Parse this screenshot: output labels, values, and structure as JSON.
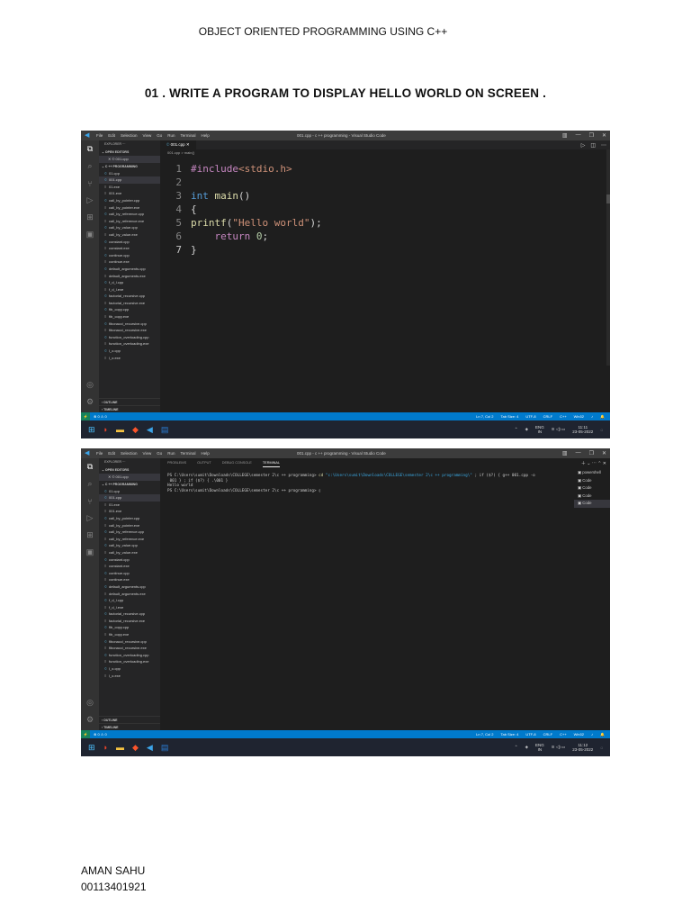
{
  "document": {
    "header": "OBJECT ORIENTED PROGRAMMING USING C++",
    "question": "01 . WRITE A PROGRAM TO DISPLAY HELLO WORLD ON SCREEN .",
    "author_name": "AMAN SAHU",
    "author_id": "00113401921"
  },
  "vscode": {
    "menu": [
      "File",
      "Edit",
      "Selection",
      "View",
      "Go",
      "Run",
      "Terminal",
      "Help"
    ],
    "window_title": "001.cpp - c ++ programming - Visual Studio Code",
    "explorer_label": "EXPLORER",
    "open_editors_label": "OPEN EDITORS",
    "open_editor_file": "001.cpp",
    "folder_label": "C ++ PROGRAMMING",
    "files": [
      "01.cpp",
      "001.cpp",
      "01.exe",
      "001.exe",
      "call_by_pointer.cpp",
      "call_by_pointer.exe",
      "call_by_reference.cpp",
      "call_by_reference.exe",
      "call_by_value.cpp",
      "call_by_value.exe",
      "constant.cpp",
      "constant.exe",
      "continue.cpp",
      "continue.exe",
      "default_arguments.cpp",
      "default_arguments.exe",
      "f_d_l.cpp",
      "f_d_l.exe",
      "factorial_recursive.cpp",
      "factorial_recursive.exe",
      "fib_copy.cpp",
      "fib_copy.exe",
      "fibonacci_recursive.cpp",
      "fibonacci_recursive.exe",
      "function_overloading.cpp",
      "function_overloading.exe",
      "l_o.cpp",
      "l_o.exe"
    ],
    "selected_file": "001.cpp",
    "outline_label": "OUTLINE",
    "timeline_label": "TIMELINE",
    "tab_label": "001.cpp",
    "breadcrumb": "001.cpp > main()",
    "status_left": "⊗ 0 ⚠ 0",
    "status_right": [
      "Ln 7, Col 2",
      "Tab Size: 4",
      "UTF-8",
      "CRLF",
      "C++",
      "Win32"
    ],
    "tray_lang": [
      "ENG",
      "IN"
    ],
    "time_1": "11:11",
    "time_2": "11:12",
    "date": "23-05-2022",
    "panel_tabs": [
      "PROBLEMS",
      "OUTPUT",
      "DEBUG CONSOLE",
      "TERMINAL"
    ],
    "terminal_list": [
      "powershell",
      "Code",
      "Code",
      "Code",
      "Code"
    ]
  },
  "code_lines": [
    {
      "n": "1",
      "html": "<span class='pp'>#include</span><span class='inc'>&lt;stdio.h&gt;</span>"
    },
    {
      "n": "2",
      "html": ""
    },
    {
      "n": "3",
      "html": "<span class='kw'>int</span> <span class='fn'>main</span><span class='tx'>()</span>"
    },
    {
      "n": "4",
      "html": "<span class='tx'>{</span>"
    },
    {
      "n": "5",
      "html": "<span class='fn'>printf</span><span class='tx'>(</span><span class='st'>\"Hello world\"</span><span class='tx'>);</span>"
    },
    {
      "n": "6",
      "html": "<span class='tx'>    </span><span class='pp'>return</span> <span class='nm'>0</span><span class='tx'>;</span>"
    },
    {
      "n": "7",
      "html": "<span class='tx'>}</span>"
    }
  ],
  "terminal": {
    "prompt": "PS C:\\Users\\sumit\\Downloads\\COLLEGE\\semester 2\\c ++ programming> ",
    "cmd_cd": "cd ",
    "cmd_path": "\"c:\\Users\\sumit\\Downloads\\COLLEGE\\semester 2\\c ++ programming\\\"",
    "cmd_rest": " ; if ($?) { g++ 001.cpp -o",
    "line2": " 001 } ; if ($?) { .\\001 }",
    "output": "Hello world",
    "cursor": "▯"
  }
}
